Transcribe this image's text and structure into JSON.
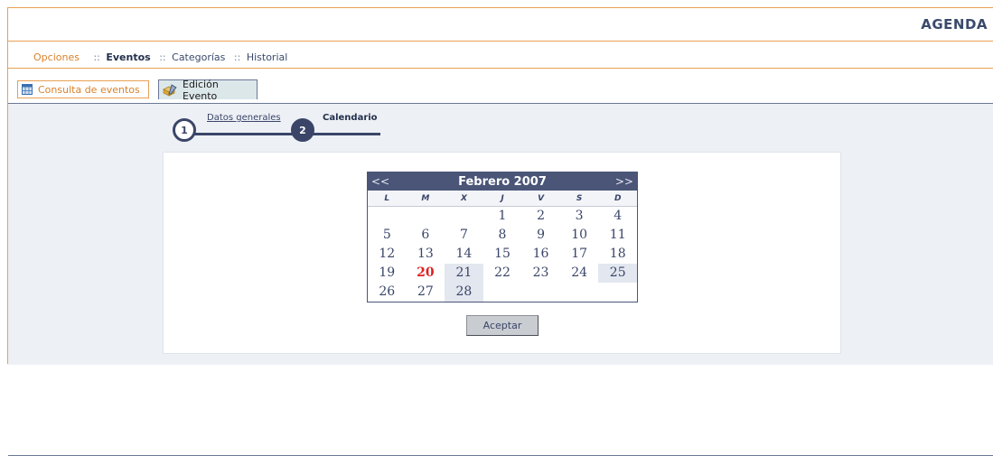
{
  "header": {
    "title": "AGENDA"
  },
  "nav": {
    "options": "Opciones",
    "sep": "::",
    "items": [
      "Eventos",
      "Categorías",
      "Historial"
    ]
  },
  "tabs": [
    {
      "label": "Consulta de eventos",
      "icon": "calendar-icon"
    },
    {
      "label": "Edición Evento",
      "icon": "edit-icon"
    }
  ],
  "steps": [
    {
      "number": "1",
      "label": "Datos generales"
    },
    {
      "number": "2",
      "label": "Calendario"
    }
  ],
  "calendar": {
    "title": "Febrero 2007",
    "prev": "<<",
    "next": ">>",
    "weekdays": [
      "L",
      "M",
      "X",
      "J",
      "V",
      "S",
      "D"
    ],
    "days": [
      "",
      "",
      "",
      "1",
      "2",
      "3",
      "4",
      "5",
      "6",
      "7",
      "8",
      "9",
      "10",
      "11",
      "12",
      "13",
      "14",
      "15",
      "16",
      "17",
      "18",
      "19",
      "20",
      "21",
      "22",
      "23",
      "24",
      "25",
      "26",
      "27",
      "28",
      "",
      "",
      "",
      ""
    ],
    "today": "20"
  },
  "accept_label": "Aceptar",
  "colors": {
    "accent": "#e8a054",
    "primary": "#4a5578",
    "today": "#e02020"
  }
}
